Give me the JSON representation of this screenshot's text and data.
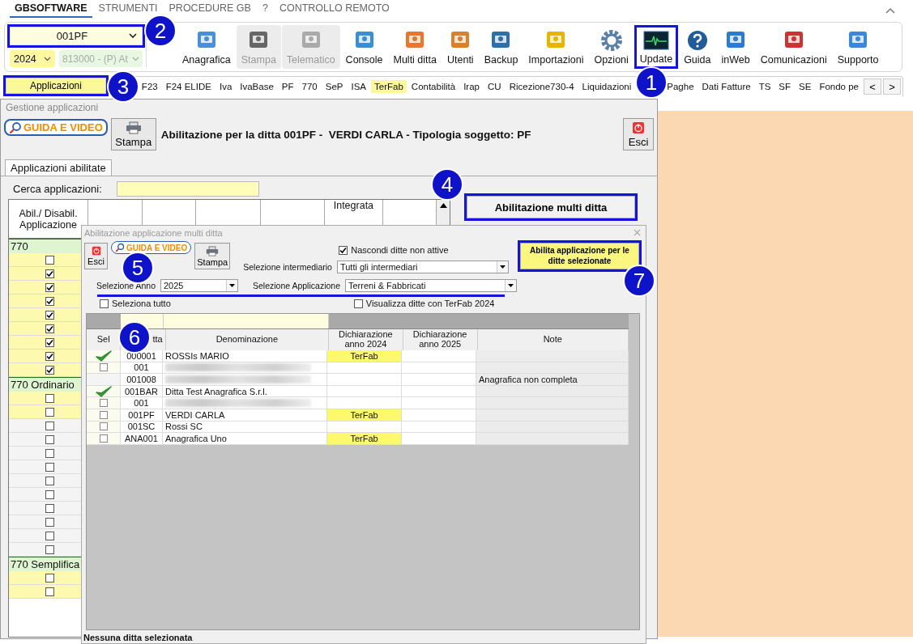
{
  "menu": [
    {
      "label": "GBSOFTWARE",
      "selected": true
    },
    {
      "label": "STRUMENTI",
      "selected": false
    },
    {
      "label": "PROCEDURE GB",
      "selected": false
    },
    {
      "label": "?",
      "selected": false
    },
    {
      "label": "CONTROLLO REMOTO",
      "selected": false
    }
  ],
  "company": {
    "value": "001PF",
    "highlighted": true
  },
  "year": {
    "value": "2024"
  },
  "activity": {
    "value": "813000 - (P) At",
    "disabled": true
  },
  "toolbar": [
    {
      "label": "Anagrafica",
      "disabled": false,
      "highlighted": false
    },
    {
      "label": "Stampa",
      "disabled": true,
      "highlighted": false
    },
    {
      "label": "Telematico",
      "disabled": true,
      "highlighted": false
    },
    {
      "label": "Console",
      "disabled": false,
      "highlighted": false
    },
    {
      "label": "Multi ditta",
      "disabled": false,
      "highlighted": false
    },
    {
      "label": "Utenti",
      "disabled": false,
      "highlighted": false
    },
    {
      "label": "Backup",
      "disabled": false,
      "highlighted": false
    },
    {
      "label": "Importazioni",
      "disabled": false,
      "highlighted": false
    },
    {
      "label": "Opzioni",
      "disabled": false,
      "highlighted": false
    },
    {
      "label": "Update",
      "disabled": false,
      "highlighted": true
    },
    {
      "label": "Guida",
      "disabled": false,
      "highlighted": false
    },
    {
      "label": "inWeb",
      "disabled": false,
      "highlighted": false
    },
    {
      "label": "Comunicazioni",
      "disabled": false,
      "highlighted": false
    },
    {
      "label": "Supporto",
      "disabled": false,
      "highlighted": false
    }
  ],
  "app_button": {
    "label": "Applicazioni",
    "highlighted": true
  },
  "app_tabs": [
    {
      "label": "F23",
      "selected": false
    },
    {
      "label": "F24 ELIDE",
      "selected": false
    },
    {
      "label": "Iva",
      "selected": false
    },
    {
      "label": "IvaBase",
      "selected": false
    },
    {
      "label": "PF",
      "selected": false
    },
    {
      "label": "770",
      "selected": false
    },
    {
      "label": "SeP",
      "selected": false
    },
    {
      "label": "ISA",
      "selected": false
    },
    {
      "label": "TerFab",
      "selected": true
    },
    {
      "label": "Contabilità",
      "selected": false
    },
    {
      "label": "Irap",
      "selected": false
    },
    {
      "label": "CU",
      "selected": false
    },
    {
      "label": "Ricezione730-4",
      "selected": false
    },
    {
      "label": "Liquidazioni",
      "selected": false
    },
    {
      "label": "Paghe",
      "selected": false
    },
    {
      "label": "Dati Fatture",
      "selected": false
    },
    {
      "label": "TS",
      "selected": false
    },
    {
      "label": "SF",
      "selected": false
    },
    {
      "label": "SE",
      "selected": false
    },
    {
      "label": "Fondo pe",
      "selected": false
    }
  ],
  "tab_scroll": [
    "<",
    ">"
  ],
  "window": {
    "title": "Gestione applicazioni",
    "guide_button": "GUIDA E VIDEO",
    "print_button": "Stampa",
    "heading": "Abilitazione per la ditta 001PF -  VERDI CARLA - Tipologia soggetto: PF",
    "exit_button": "Esci",
    "tab": {
      "label": "Applicazioni abilitate",
      "selected": true
    },
    "search_label": "Cerca applicazioni:",
    "multi_button": {
      "label": "Abilitazione multi ditta",
      "highlighted": true
    },
    "table": {
      "column_1": "Abil./ Disabil. Applicazione",
      "column_6": "Integrata",
      "rows": [
        {
          "kind": "group",
          "label": "770"
        },
        {
          "kind": "app",
          "checked": false,
          "available": true
        },
        {
          "kind": "app",
          "checked": true,
          "available": true
        },
        {
          "kind": "app",
          "checked": true,
          "available": true
        },
        {
          "kind": "app",
          "checked": true,
          "available": true
        },
        {
          "kind": "app",
          "checked": true,
          "available": true
        },
        {
          "kind": "app",
          "checked": true,
          "available": true
        },
        {
          "kind": "app",
          "checked": true,
          "available": true
        },
        {
          "kind": "app",
          "checked": true,
          "available": true
        },
        {
          "kind": "app",
          "checked": true,
          "available": true
        },
        {
          "kind": "group",
          "label": "770 Ordinario"
        },
        {
          "kind": "app",
          "checked": false,
          "available": true
        },
        {
          "kind": "app",
          "checked": false,
          "available": true
        },
        {
          "kind": "app",
          "checked": false,
          "available": false
        },
        {
          "kind": "app",
          "checked": false,
          "available": false
        },
        {
          "kind": "app",
          "checked": false,
          "available": false
        },
        {
          "kind": "app",
          "checked": false,
          "available": false
        },
        {
          "kind": "app",
          "checked": false,
          "available": false
        },
        {
          "kind": "app",
          "checked": false,
          "available": false
        },
        {
          "kind": "app",
          "checked": false,
          "available": false
        },
        {
          "kind": "app",
          "checked": false,
          "available": false
        },
        {
          "kind": "app",
          "checked": false,
          "available": false
        },
        {
          "kind": "app",
          "checked": false,
          "available": false
        },
        {
          "kind": "group",
          "label": "770 Semplifica"
        },
        {
          "kind": "app",
          "checked": false,
          "available": true
        },
        {
          "kind": "app",
          "checked": false,
          "available": true
        }
      ]
    }
  },
  "dialog": {
    "title": "Abilitazione applicazione multi ditta",
    "exit_button": "Esci",
    "guide_button": "GUIDA E VIDEO",
    "print_button": "Stampa",
    "hide_inactive": {
      "label": "Nascondi ditte non attive",
      "checked": true
    },
    "intermediary": {
      "label": "Selezione intermediario",
      "value": "Tutti gli intermediari"
    },
    "year": {
      "label": "Selezione Anno",
      "value": "2025"
    },
    "application": {
      "label": "Selezione Applicazione",
      "value": "Terreni & Fabbricati"
    },
    "select_all": {
      "label": "Seleziona tutto",
      "checked": false
    },
    "show_terfab": {
      "label": "Visualizza ditte con TerFab 2024",
      "checked": false
    },
    "enable_button": {
      "label": "Abilita applicazione per le ditte selezionate",
      "highlighted": true
    },
    "columns": [
      "Sel",
      "tta",
      "Denominazione",
      "Dichiarazione anno 2024",
      "Dichiarazione anno 2025",
      "Note"
    ],
    "rows": [
      {
        "kind": "selectable",
        "selected": true,
        "code": "000001",
        "name": "ROSSIs MARIO",
        "decl_2024": "TerFab"
      },
      {
        "kind": "selectable",
        "selected": false,
        "code": "001",
        "name_redacted": true
      },
      {
        "kind": "locked",
        "selected": false,
        "code": "001008",
        "name_redacted": true,
        "note": "Anagrafica non completa"
      },
      {
        "kind": "selectable",
        "selected": true,
        "code": "001BAR",
        "name": "Ditta Test Anagrafica S.r.l."
      },
      {
        "kind": "selectable",
        "selected": false,
        "code": "001",
        "name_redacted": true
      },
      {
        "kind": "selectable",
        "selected": false,
        "code": "001PF",
        "name": "VERDI CARLA",
        "decl_2024": "TerFab"
      },
      {
        "kind": "selectable",
        "selected": false,
        "code": "001SC",
        "name": "Rossi SC"
      },
      {
        "kind": "selectable",
        "selected": false,
        "code": "ANA001",
        "name": "Anagrafica Uno",
        "decl_2024": "TerFab"
      }
    ],
    "status": "Nessuna ditta selezionata"
  },
  "annotations": [
    "1",
    "2",
    "3",
    "4",
    "5",
    "6",
    "7"
  ]
}
